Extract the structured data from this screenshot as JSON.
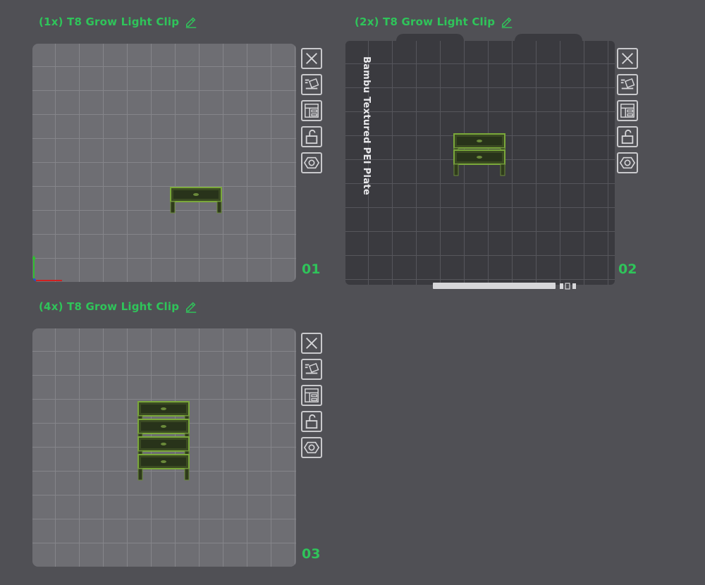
{
  "plates": [
    {
      "title": "(1x) T8 Grow Light Clip",
      "number": "01"
    },
    {
      "title": "(2x) T8 Grow Light Clip",
      "number": "02",
      "plate_label": "Bambu Textured PEI Plate"
    },
    {
      "title": "(4x) T8 Grow Light Clip",
      "number": "03"
    }
  ],
  "icons": {
    "edit": "pencil-icon",
    "toolbar": [
      "close-icon",
      "auto-orient-icon",
      "arrange-icon",
      "lock-icon",
      "settings-icon"
    ]
  },
  "colors": {
    "accent": "#2fc45a",
    "plate_light": "#6e6e73",
    "plate_dark": "#3a3a3f",
    "part": "#3a4a22",
    "part_edge": "#7aa83a",
    "background": "#505055"
  }
}
